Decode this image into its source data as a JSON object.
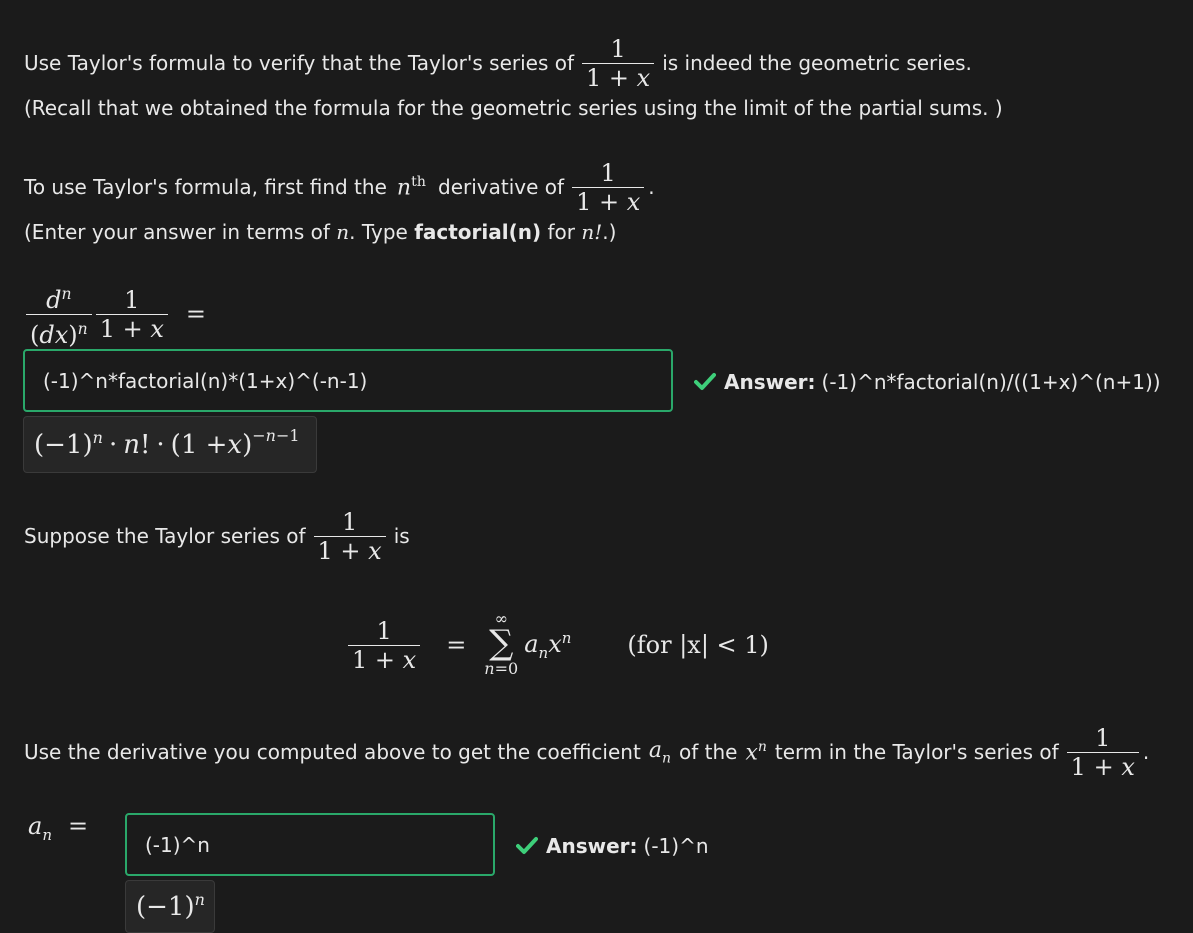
{
  "prompt": {
    "line1_before": "Use Taylor's formula to verify that the Taylor's series of",
    "line1_after": "is indeed the geometric series.",
    "line2": "(Recall that we obtained the formula for the geometric series using the limit of the partial sums. )"
  },
  "part1": {
    "intro_before": "To use Taylor's formula, first find the",
    "intro_mid": "derivative of",
    "hint_before": "(Enter your answer in terms of",
    "hint_mid": ". Type",
    "hint_bold": "factorial(n)",
    "hint_after": "for",
    "input_value": "(-1)^n*factorial(n)*(1+x)^(-n-1)",
    "answer_label": "Answer:",
    "answer_value": "(-1)^n*factorial(n)/((1+x)^(n+1))"
  },
  "part2": {
    "suppose_before": "Suppose the Taylor series of",
    "suppose_after": "is",
    "condition": "(for |x| < 1)",
    "use_before": "Use the derivative you computed above to get the coefficient",
    "use_mid": "of the",
    "use_after": "term in the Taylor's series of",
    "input_value": "(-1)^n",
    "answer_label": "Answer:",
    "answer_value": "(-1)^n"
  },
  "math": {
    "one": "1",
    "one_plus_x": "1 + x",
    "n": "n",
    "th": "th",
    "n_fact": "n!"
  },
  "colors": {
    "background": "#1b1b1b",
    "text": "#e8e8e8",
    "correct": "#2aa86a",
    "check": "#3ecf7a"
  },
  "icons": {
    "check": "check-icon"
  }
}
